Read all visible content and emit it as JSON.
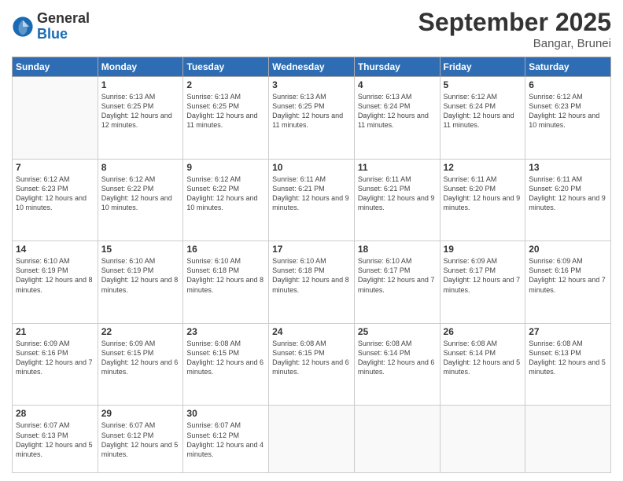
{
  "header": {
    "logo_general": "General",
    "logo_blue": "Blue",
    "title": "September 2025",
    "location": "Bangar, Brunei"
  },
  "days_of_week": [
    "Sunday",
    "Monday",
    "Tuesday",
    "Wednesday",
    "Thursday",
    "Friday",
    "Saturday"
  ],
  "weeks": [
    [
      {
        "day": "",
        "info": ""
      },
      {
        "day": "1",
        "info": "Sunrise: 6:13 AM\nSunset: 6:25 PM\nDaylight: 12 hours\nand 12 minutes."
      },
      {
        "day": "2",
        "info": "Sunrise: 6:13 AM\nSunset: 6:25 PM\nDaylight: 12 hours\nand 11 minutes."
      },
      {
        "day": "3",
        "info": "Sunrise: 6:13 AM\nSunset: 6:25 PM\nDaylight: 12 hours\nand 11 minutes."
      },
      {
        "day": "4",
        "info": "Sunrise: 6:13 AM\nSunset: 6:24 PM\nDaylight: 12 hours\nand 11 minutes."
      },
      {
        "day": "5",
        "info": "Sunrise: 6:12 AM\nSunset: 6:24 PM\nDaylight: 12 hours\nand 11 minutes."
      },
      {
        "day": "6",
        "info": "Sunrise: 6:12 AM\nSunset: 6:23 PM\nDaylight: 12 hours\nand 10 minutes."
      }
    ],
    [
      {
        "day": "7",
        "info": "Sunrise: 6:12 AM\nSunset: 6:23 PM\nDaylight: 12 hours\nand 10 minutes."
      },
      {
        "day": "8",
        "info": "Sunrise: 6:12 AM\nSunset: 6:22 PM\nDaylight: 12 hours\nand 10 minutes."
      },
      {
        "day": "9",
        "info": "Sunrise: 6:12 AM\nSunset: 6:22 PM\nDaylight: 12 hours\nand 10 minutes."
      },
      {
        "day": "10",
        "info": "Sunrise: 6:11 AM\nSunset: 6:21 PM\nDaylight: 12 hours\nand 9 minutes."
      },
      {
        "day": "11",
        "info": "Sunrise: 6:11 AM\nSunset: 6:21 PM\nDaylight: 12 hours\nand 9 minutes."
      },
      {
        "day": "12",
        "info": "Sunrise: 6:11 AM\nSunset: 6:20 PM\nDaylight: 12 hours\nand 9 minutes."
      },
      {
        "day": "13",
        "info": "Sunrise: 6:11 AM\nSunset: 6:20 PM\nDaylight: 12 hours\nand 9 minutes."
      }
    ],
    [
      {
        "day": "14",
        "info": "Sunrise: 6:10 AM\nSunset: 6:19 PM\nDaylight: 12 hours\nand 8 minutes."
      },
      {
        "day": "15",
        "info": "Sunrise: 6:10 AM\nSunset: 6:19 PM\nDaylight: 12 hours\nand 8 minutes."
      },
      {
        "day": "16",
        "info": "Sunrise: 6:10 AM\nSunset: 6:18 PM\nDaylight: 12 hours\nand 8 minutes."
      },
      {
        "day": "17",
        "info": "Sunrise: 6:10 AM\nSunset: 6:18 PM\nDaylight: 12 hours\nand 8 minutes."
      },
      {
        "day": "18",
        "info": "Sunrise: 6:10 AM\nSunset: 6:17 PM\nDaylight: 12 hours\nand 7 minutes."
      },
      {
        "day": "19",
        "info": "Sunrise: 6:09 AM\nSunset: 6:17 PM\nDaylight: 12 hours\nand 7 minutes."
      },
      {
        "day": "20",
        "info": "Sunrise: 6:09 AM\nSunset: 6:16 PM\nDaylight: 12 hours\nand 7 minutes."
      }
    ],
    [
      {
        "day": "21",
        "info": "Sunrise: 6:09 AM\nSunset: 6:16 PM\nDaylight: 12 hours\nand 7 minutes."
      },
      {
        "day": "22",
        "info": "Sunrise: 6:09 AM\nSunset: 6:15 PM\nDaylight: 12 hours\nand 6 minutes."
      },
      {
        "day": "23",
        "info": "Sunrise: 6:08 AM\nSunset: 6:15 PM\nDaylight: 12 hours\nand 6 minutes."
      },
      {
        "day": "24",
        "info": "Sunrise: 6:08 AM\nSunset: 6:15 PM\nDaylight: 12 hours\nand 6 minutes."
      },
      {
        "day": "25",
        "info": "Sunrise: 6:08 AM\nSunset: 6:14 PM\nDaylight: 12 hours\nand 6 minutes."
      },
      {
        "day": "26",
        "info": "Sunrise: 6:08 AM\nSunset: 6:14 PM\nDaylight: 12 hours\nand 5 minutes."
      },
      {
        "day": "27",
        "info": "Sunrise: 6:08 AM\nSunset: 6:13 PM\nDaylight: 12 hours\nand 5 minutes."
      }
    ],
    [
      {
        "day": "28",
        "info": "Sunrise: 6:07 AM\nSunset: 6:13 PM\nDaylight: 12 hours\nand 5 minutes."
      },
      {
        "day": "29",
        "info": "Sunrise: 6:07 AM\nSunset: 6:12 PM\nDaylight: 12 hours\nand 5 minutes."
      },
      {
        "day": "30",
        "info": "Sunrise: 6:07 AM\nSunset: 6:12 PM\nDaylight: 12 hours\nand 4 minutes."
      },
      {
        "day": "",
        "info": ""
      },
      {
        "day": "",
        "info": ""
      },
      {
        "day": "",
        "info": ""
      },
      {
        "day": "",
        "info": ""
      }
    ]
  ]
}
